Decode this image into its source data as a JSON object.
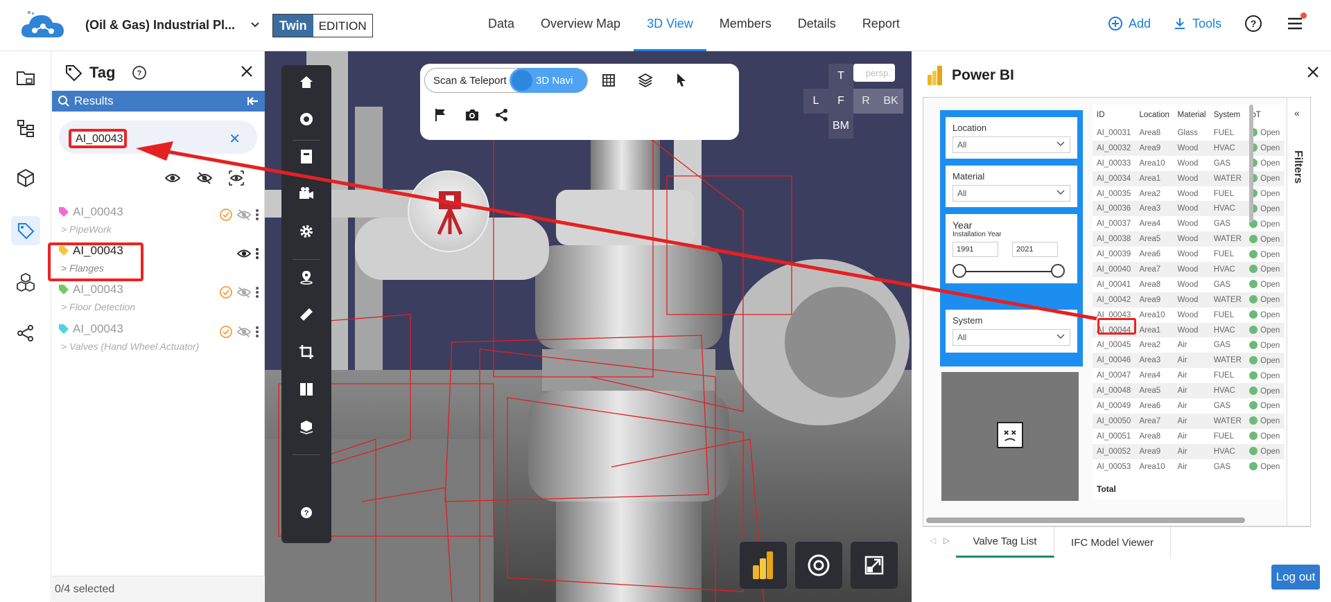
{
  "header": {
    "project_name": "(Oil & Gas) Industrial Pl...",
    "edition_twin": "Twin",
    "edition_label": "EDITION",
    "tabs": [
      {
        "label": "Data"
      },
      {
        "label": "Overview Map"
      },
      {
        "label": "3D View",
        "active": true
      },
      {
        "label": "Members"
      },
      {
        "label": "Details"
      },
      {
        "label": "Report"
      }
    ],
    "add_label": "Add",
    "tools_label": "Tools",
    "accent_color": "#1a7ee0"
  },
  "tag_panel": {
    "title": "Tag",
    "results_label": "Results",
    "search_value": "AI_00043",
    "items": [
      {
        "name": "AI_00043",
        "category": "> PipeWork",
        "color": "#f06bd6"
      },
      {
        "name": "AI_00043",
        "category": "> Flanges",
        "color": "#f5c542"
      },
      {
        "name": "AI_00043",
        "category": "> Floor Detection",
        "color": "#74c95d"
      },
      {
        "name": "AI_00043",
        "category": "> Valves (Hand Wheel Actuator)",
        "color": "#4fd3e3"
      }
    ],
    "selection_status": "0/4 selected"
  },
  "viewport": {
    "scan_teleport_label": "Scan & Teleport",
    "navi_label": "3D Navi",
    "view_buttons": {
      "top": "T",
      "left": "L",
      "front": "F",
      "right": "R",
      "back": "BK",
      "bottom": "BM",
      "perspective": "persp."
    }
  },
  "powerbi": {
    "title": "Power BI",
    "slicers": {
      "location_label": "Location",
      "location_value": "All",
      "material_label": "Material",
      "material_value": "All",
      "year_label": "Year",
      "year_sub": "Installation Year",
      "year_from": "1991",
      "year_to": "2021",
      "system_label": "System",
      "system_value": "All"
    },
    "filters_label": "Filters",
    "table": {
      "columns": [
        "ID",
        "Location",
        "Material",
        "System",
        "IoT"
      ],
      "rows": [
        [
          "AI_00031",
          "Area8",
          "Glass",
          "FUEL",
          "Open"
        ],
        [
          "AI_00032",
          "Area9",
          "Wood",
          "HVAC",
          "Open"
        ],
        [
          "AI_00033",
          "Area10",
          "Wood",
          "GAS",
          "Open"
        ],
        [
          "AI_00034",
          "Area1",
          "Wood",
          "WATER",
          "Open"
        ],
        [
          "AI_00035",
          "Area2",
          "Wood",
          "FUEL",
          "Open"
        ],
        [
          "AI_00036",
          "Area3",
          "Wood",
          "HVAC",
          "Open"
        ],
        [
          "AI_00037",
          "Area4",
          "Wood",
          "GAS",
          "Open"
        ],
        [
          "AI_00038",
          "Area5",
          "Wood",
          "WATER",
          "Open"
        ],
        [
          "AI_00039",
          "Area6",
          "Wood",
          "FUEL",
          "Open"
        ],
        [
          "AI_00040",
          "Area7",
          "Wood",
          "HVAC",
          "Open"
        ],
        [
          "AI_00041",
          "Area8",
          "Wood",
          "GAS",
          "Open"
        ],
        [
          "AI_00042",
          "Area9",
          "Wood",
          "WATER",
          "Open"
        ],
        [
          "AI_00043",
          "Area10",
          "Wood",
          "FUEL",
          "Open"
        ],
        [
          "AI_00044",
          "Area1",
          "Wood",
          "HVAC",
          "Open"
        ],
        [
          "AI_00045",
          "Area2",
          "Air",
          "GAS",
          "Open"
        ],
        [
          "AI_00046",
          "Area3",
          "Air",
          "WATER",
          "Open"
        ],
        [
          "AI_00047",
          "Area4",
          "Air",
          "FUEL",
          "Open"
        ],
        [
          "AI_00048",
          "Area5",
          "Air",
          "HVAC",
          "Open"
        ],
        [
          "AI_00049",
          "Area6",
          "Air",
          "GAS",
          "Open"
        ],
        [
          "AI_00050",
          "Area7",
          "Air",
          "WATER",
          "Open"
        ],
        [
          "AI_00051",
          "Area8",
          "Air",
          "FUEL",
          "Open"
        ],
        [
          "AI_00052",
          "Area9",
          "Air",
          "HVAC",
          "Open"
        ],
        [
          "AI_00053",
          "Area10",
          "Air",
          "GAS",
          "Open"
        ]
      ],
      "total_label": "Total"
    },
    "tabs": [
      "Valve Tag List",
      "IFC Model Viewer"
    ],
    "logout_label": "Log out"
  }
}
